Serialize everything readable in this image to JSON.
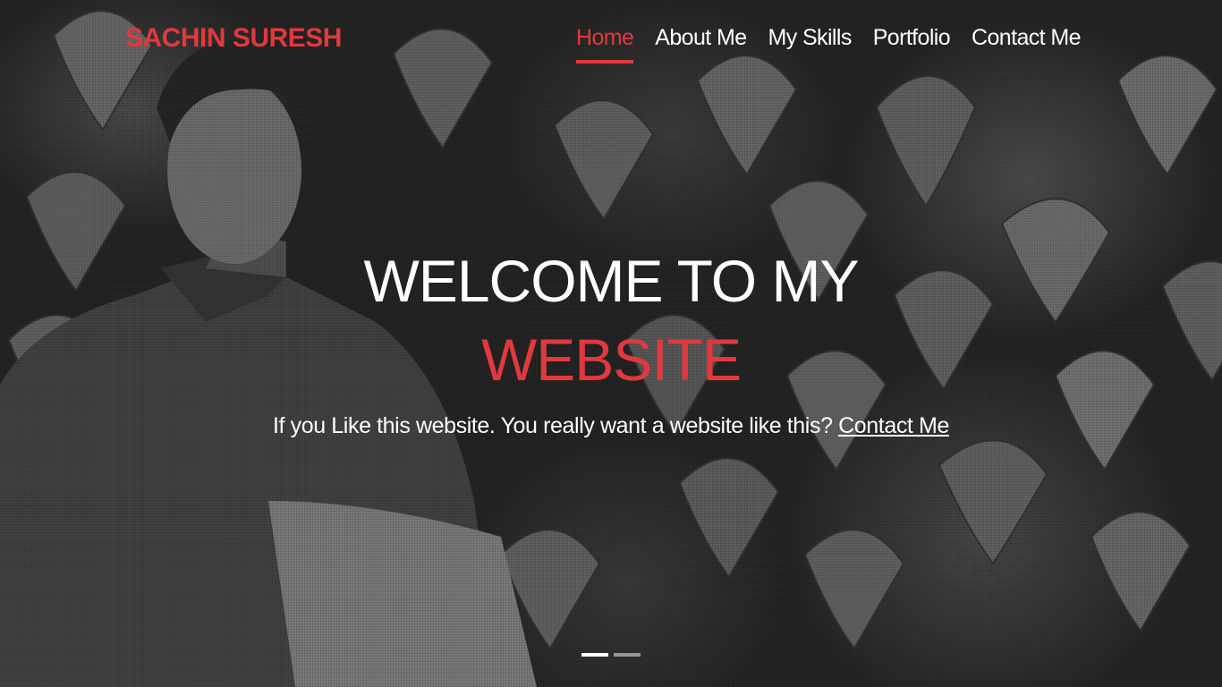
{
  "brand": {
    "name": "SACHIN SURESH",
    "accent_color": "#e0393e"
  },
  "nav": {
    "items": [
      {
        "label": "Home",
        "active": true
      },
      {
        "label": "About Me",
        "active": false
      },
      {
        "label": "My Skills",
        "active": false
      },
      {
        "label": "Portfolio",
        "active": false
      },
      {
        "label": "Contact Me",
        "active": false
      }
    ]
  },
  "hero": {
    "headline_line1": "WELCOME TO MY",
    "headline_line2": "WEBSITE",
    "tagline_text": "If you Like this website. You really want a website like this? ",
    "tagline_link": "Contact Me",
    "background": "grayscale photo of a man seated in front of a wall of leafy plants"
  },
  "carousel": {
    "slide_count": 2,
    "active_index": 0
  }
}
